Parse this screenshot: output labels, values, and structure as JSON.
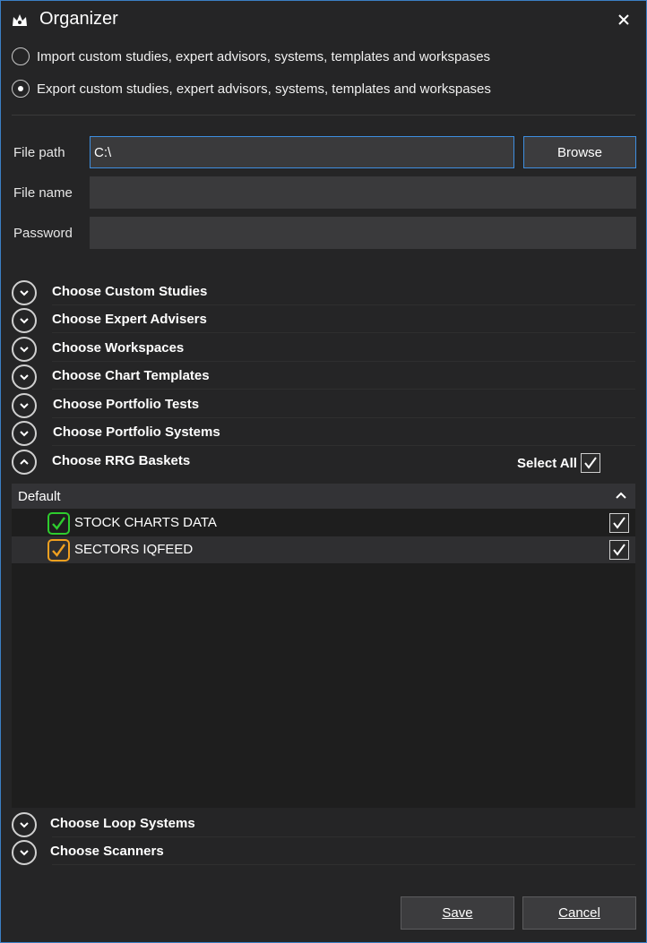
{
  "window": {
    "title": "Organizer",
    "app_icon": "crown-logo-icon",
    "close_icon": "close-icon"
  },
  "mode": {
    "import_label": "Import custom studies, expert advisors, systems, templates and workspases",
    "export_label": "Export custom studies, expert advisors, systems, templates and workspases",
    "selected": "export"
  },
  "form": {
    "file_path_label": "File path",
    "file_path_value": "C:\\",
    "browse_label": "Browse",
    "file_name_label": "File name",
    "file_name_value": "",
    "password_label": "Password",
    "password_value": ""
  },
  "sections_top": [
    {
      "label": "Choose Custom Studies",
      "expanded": false
    },
    {
      "label": "Choose Expert Advisers",
      "expanded": false
    },
    {
      "label": "Choose Workspaces",
      "expanded": false
    },
    {
      "label": "Choose Chart Templates",
      "expanded": false
    },
    {
      "label": "Choose Portfolio Tests",
      "expanded": false
    },
    {
      "label": "Choose Portfolio Systems",
      "expanded": false
    },
    {
      "label": "Choose RRG Baskets",
      "expanded": true
    }
  ],
  "rrg": {
    "select_all_label": "Select All",
    "select_all_checked": true,
    "group_header": "Default",
    "items": [
      {
        "label": "STOCK CHARTS DATA",
        "status_color": "#2ecc2e",
        "checked": true
      },
      {
        "label": "SECTORS IQFEED",
        "status_color": "#f0a020",
        "checked": true
      }
    ]
  },
  "sections_bottom": [
    {
      "label": "Choose Loop Systems",
      "expanded": false
    },
    {
      "label": "Choose Scanners",
      "expanded": false
    }
  ],
  "footer": {
    "save_label": "Save",
    "cancel_label": "Cancel"
  },
  "colors": {
    "accent": "#3e8ee0",
    "background": "#252526"
  }
}
